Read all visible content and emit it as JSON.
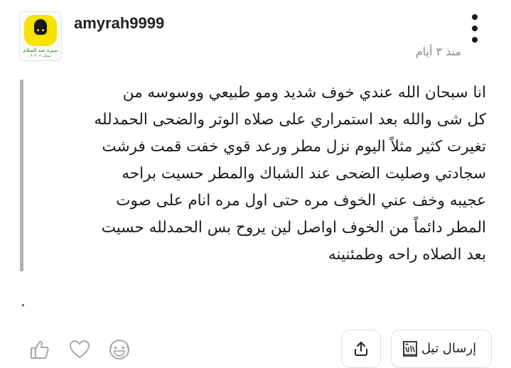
{
  "post": {
    "username": "amyrah9999",
    "timestamp": "منذ ٣ أيام",
    "avatar": {
      "caption_line1": "سيرة عبد السلام",
      "caption_line2": "سناب • ٢٠٢٠"
    },
    "body_lines": [
      "انا سبحان الله عندي خوف شديد ومو طبيعي ووسوسه من",
      "كل شى والله بعد استمراري على صلاه الوتر والضحى الحمدلله",
      "تغيرت كثير مثلاً اليوم نزل مطر ورعد قوي خفت قمت فرشت",
      "سجادتي وصليت الضحى عند الشباك والمطر حسيت براحه",
      "عجيبه وخف عني الخوف مره حتى اول مره انام على صوت",
      "المطر دائماً من الخوف اواصل لين يروح بس الحمدلله حسيت",
      "بعد الصلاه راحه وطمئنينه"
    ],
    "trailing_dot": "."
  },
  "actions": {
    "reply_label": "إرسال تيل",
    "icons": [
      "laugh-icon",
      "heart-icon",
      "thumbs-up-icon",
      "share-icon",
      "quote-reply-icon",
      "more-options-icon"
    ]
  },
  "colors": {
    "quote_bar": "#b3b3b3",
    "timestamp": "#8a8a8a",
    "icon_stroke": "#a8a8a8",
    "avatar_bg": "#f7e300"
  }
}
